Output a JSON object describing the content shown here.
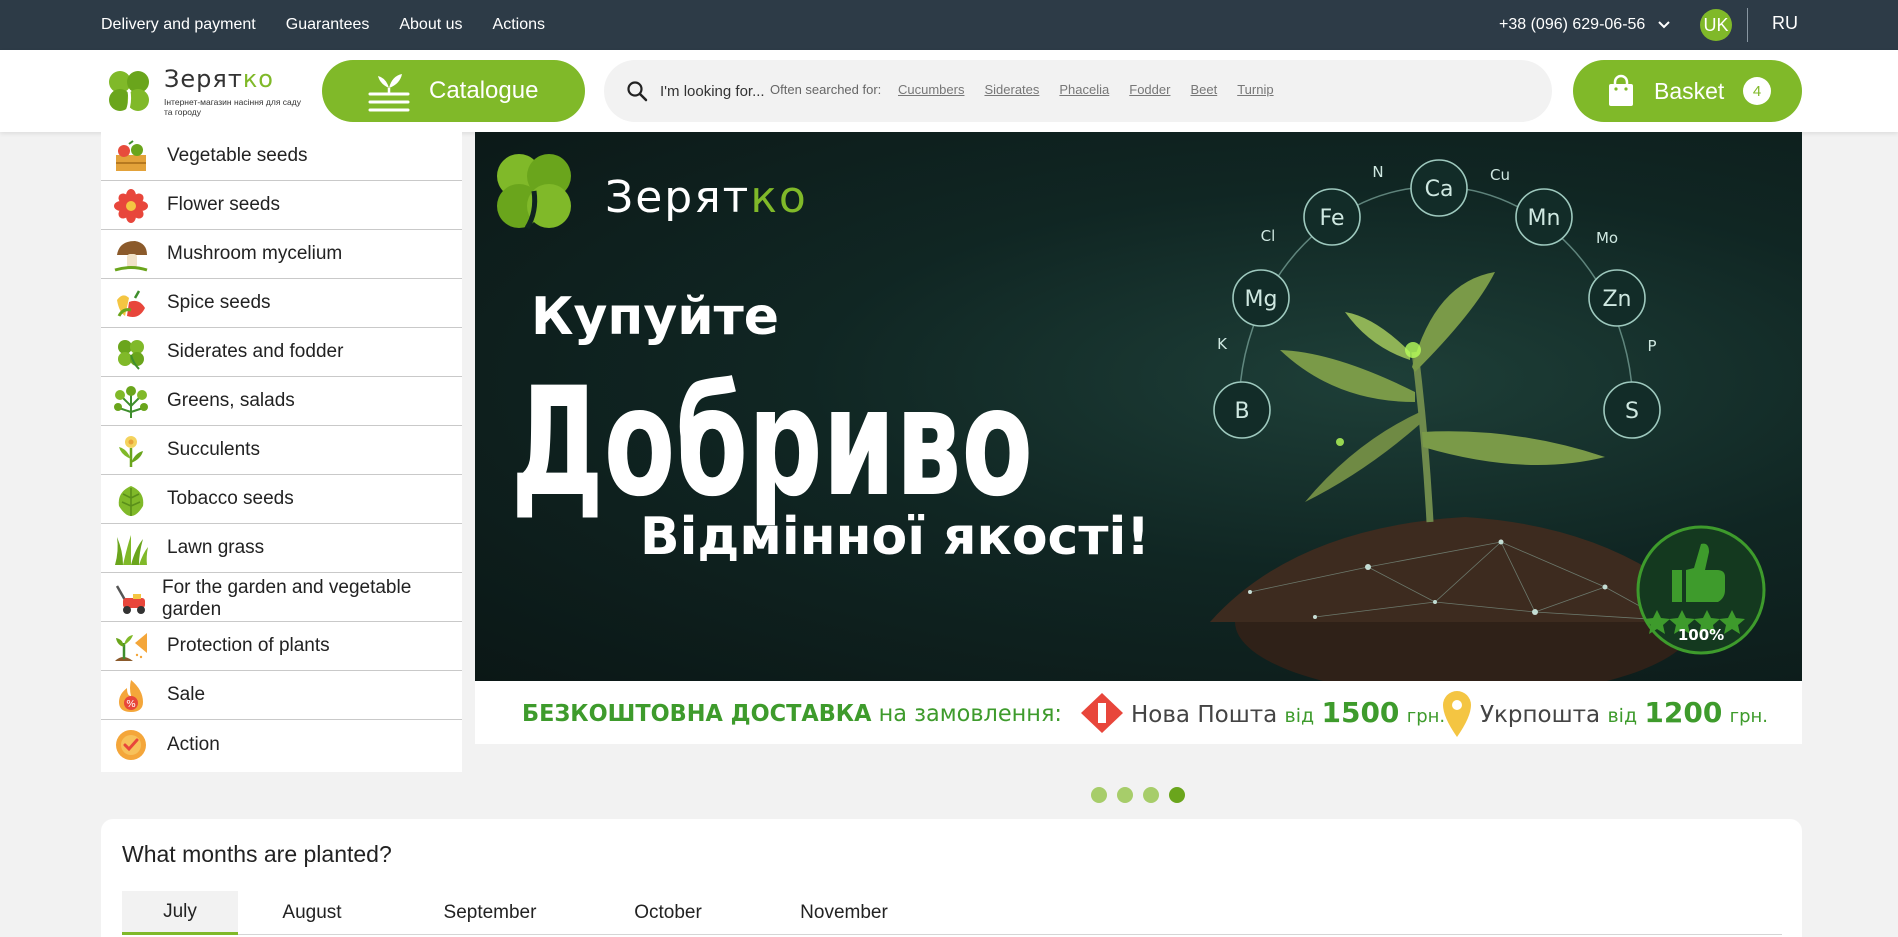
{
  "topbar": {
    "links": [
      "Delivery and payment",
      "Guarantees",
      "About us",
      "Actions"
    ],
    "phone": "+38 (096) 629-06-56",
    "lang_active": "UK",
    "lang_other": "RU"
  },
  "header": {
    "logo_name_a": "Зерят",
    "logo_name_b": "ко",
    "logo_sub": "Інтернет-магазин насіння для саду та городу",
    "catalogue_label": "Catalogue",
    "search_placeholder": "I'm looking for...",
    "often_label": "Often searched for:",
    "often_tags": [
      "Cucumbers",
      "Siderates",
      "Phacelia",
      "Fodder",
      "Beet",
      "Turnip"
    ],
    "basket_label": "Basket",
    "basket_count": "4"
  },
  "sidebar": {
    "items": [
      {
        "label": "Vegetable seeds",
        "icon": "vegetable-crate-icon"
      },
      {
        "label": "Flower seeds",
        "icon": "flower-icon"
      },
      {
        "label": "Mushroom mycelium",
        "icon": "mushroom-icon"
      },
      {
        "label": "Spice seeds",
        "icon": "pepper-icon"
      },
      {
        "label": "Siderates and fodder",
        "icon": "clover-icon"
      },
      {
        "label": "Greens, salads",
        "icon": "parsley-icon"
      },
      {
        "label": "Succulents",
        "icon": "succulent-icon"
      },
      {
        "label": "Tobacco seeds",
        "icon": "tobacco-leaf-icon"
      },
      {
        "label": "Lawn grass",
        "icon": "grass-icon"
      },
      {
        "label": "For the garden and vegetable garden",
        "icon": "lawnmower-icon"
      },
      {
        "label": "Protection of plants",
        "icon": "sprout-shield-icon"
      },
      {
        "label": "Sale",
        "icon": "sale-fire-icon"
      },
      {
        "label": "Action",
        "icon": "action-badge-icon"
      }
    ]
  },
  "banner": {
    "brand_a": "Зерят",
    "brand_b": "ко",
    "line1": "Купуйте",
    "line2": "Добриво",
    "line3": "Відмінної якості!",
    "elements_big": [
      "Ca",
      "Fe",
      "Mn",
      "Mg",
      "Zn",
      "B",
      "S"
    ],
    "elements_small": [
      "N",
      "Cu",
      "Cl",
      "Mo",
      "K",
      "P"
    ],
    "badge": "100%",
    "delivery_label": "БЕЗКОШТОВНА ДОСТАВКА",
    "delivery_on": "на замовлення:",
    "np_name": "Нова Пошта",
    "from1": "від",
    "np_amount": "1500",
    "currency1": "грн.",
    "up_name": "Укрпошта",
    "from2": "від",
    "up_amount": "1200",
    "currency2": "грн."
  },
  "slider": {
    "count": 4,
    "active": 4
  },
  "months": {
    "title": "What months are planted?",
    "tabs": [
      "July",
      "August",
      "September",
      "October",
      "November"
    ],
    "active": "July"
  },
  "colors": {
    "accent": "#80b929",
    "topbar": "#2d3b47"
  }
}
